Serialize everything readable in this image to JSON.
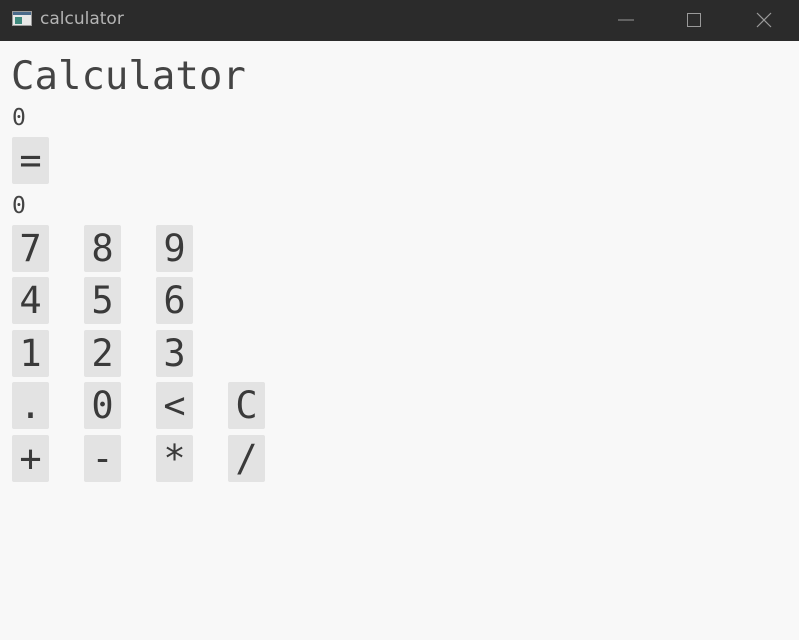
{
  "window": {
    "title": "calculator",
    "controls": [
      "minimize",
      "maximize",
      "close"
    ]
  },
  "app": {
    "heading": "Calculator",
    "primary_display": "0",
    "equals_label": "=",
    "secondary_display": "0"
  },
  "keypad": {
    "row1": [
      "7",
      "8",
      "9"
    ],
    "row2": [
      "4",
      "5",
      "6"
    ],
    "row3": [
      "1",
      "2",
      "3"
    ],
    "row4": [
      ".",
      "0",
      "<",
      "C"
    ],
    "row5": [
      "+",
      "-",
      "*",
      "/"
    ]
  },
  "colors": {
    "titlebar": "#2b2b2b",
    "background": "#f8f8f8",
    "key": "#e3e3e3",
    "text": "#3a3a3a"
  }
}
